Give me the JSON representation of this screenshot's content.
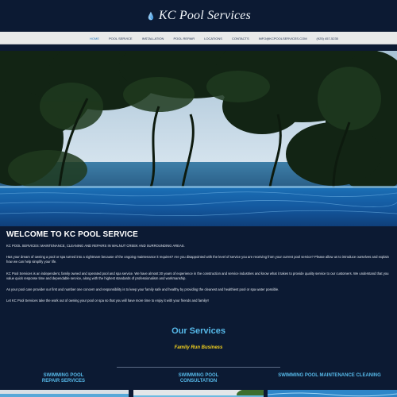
{
  "header": {
    "brand": "KC Pool Services",
    "logo_icon": "water-drop-icon"
  },
  "nav": {
    "items": [
      {
        "label": "HOME",
        "active": true
      },
      {
        "label": "POOL SERVICE"
      },
      {
        "label": "INSTALLATION"
      },
      {
        "label": "POOL REPAIR"
      },
      {
        "label": "LOCATIONS"
      },
      {
        "label": "CONTACTS"
      },
      {
        "label": "INFO@KCPOOLSERVICES.COM"
      },
      {
        "label": "(925) 457-5235"
      }
    ]
  },
  "main": {
    "welcome_title": "WELCOME TO KC POOL SERVICE",
    "p1": "KC POOL SERVICES: MAINTENANCE, CLEANING AND REPAIRS IN WALNUT CREEK AND SURROUNDING AREAS.",
    "p2": "Has your dream of owning a pool or spa turned into a nightmare because of the ongoing maintenance it requires? Are you disappointed with the level of service you are receiving from your current pool service? Please allow us to introduce ourselves and explain how we can help simplify your life.",
    "p3": "KC Pool Services is an independent, family owned and operated pool and spa service. We have almost 30 years of experience in the construction and service industries and know what it takes to provide quality service to our customers. We understand that you value quick response time and dependable service, along with the highest standards of professionalism and workmanship.",
    "p4": "As your pool care provider our first and number one concern and responsibility is to keep your family safe and healthy by providing the cleanest and healthiest pool or spa water possible.",
    "p5": "Let KC Pool Services take the work out of owning your pool or spa so that you will have more time to enjoy it with your friends and family!!"
  },
  "services": {
    "title": "Our Services",
    "subtitle": "Family Run Business",
    "items": [
      {
        "line1": "SWIMMING POOL",
        "line2": "REPAIR SERVICES"
      },
      {
        "line1": "SWIMMING POOL",
        "line2": "CONSULTATION"
      },
      {
        "line1": "SWIMMING POOL MAINTENANCE CLEANING",
        "line2": ""
      }
    ]
  },
  "colors": {
    "background": "#0c1a33",
    "accent": "#56b8e8",
    "highlight": "#f5d21e",
    "nav_bg": "#e9eaea"
  }
}
